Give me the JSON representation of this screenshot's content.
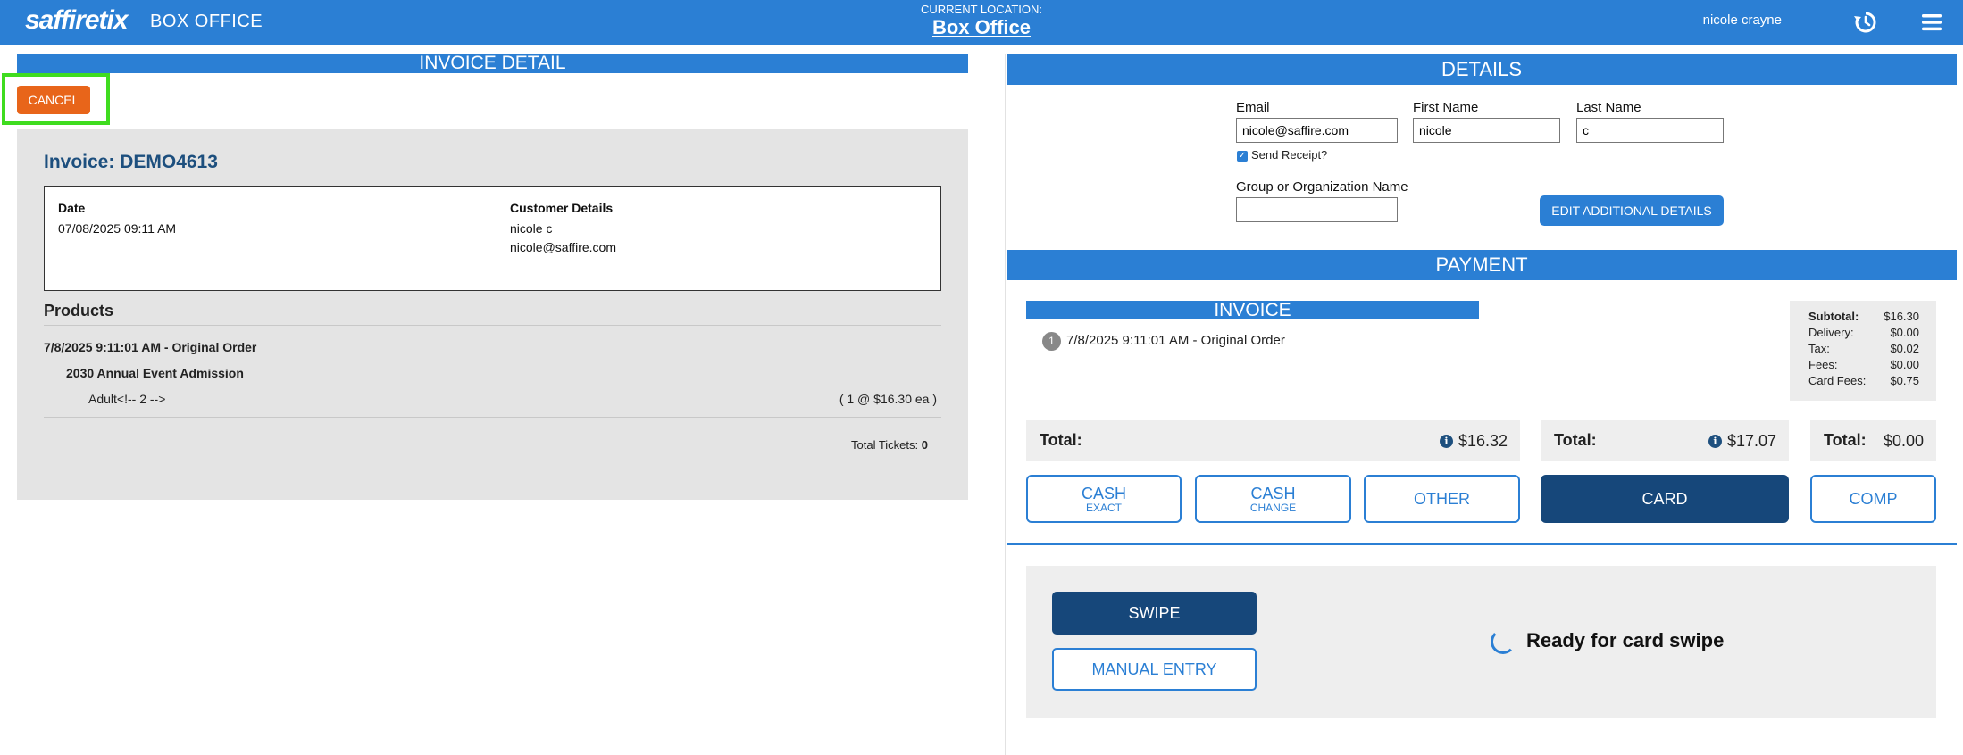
{
  "app": {
    "logo": "saffiretix",
    "title": "BOX OFFICE"
  },
  "location": {
    "label": "CURRENT LOCATION:",
    "value": "Box Office"
  },
  "user": {
    "name": "nicole crayne"
  },
  "icons": {
    "history": "history-icon",
    "menu": "hamburger-menu-icon",
    "info": "info-icon",
    "spinner": "loading-spinner-icon",
    "check": "checkbox-checked-icon"
  },
  "colors": {
    "brand": "#2b7fd4",
    "dark": "#16477a",
    "cancel": "#e8651a",
    "highlight": "#3fdc1f"
  },
  "invoice_detail": {
    "header": "INVOICE DETAIL",
    "cancel_label": "CANCEL",
    "title": "Invoice: DEMO4613",
    "date_label": "Date",
    "date_value": "07/08/2025 09:11 AM",
    "customer_label": "Customer Details",
    "customer_name": "nicole c",
    "customer_email": "nicole@saffire.com",
    "products_label": "Products",
    "order_line": "7/8/2025 9:11:01 AM - Original Order",
    "event_name": "2030 Annual Event Admission",
    "ticket_type": "Adult<!-- 2 -->",
    "ticket_qty": "( 1 @ $16.30 ea )",
    "total_tickets_label": "Total Tickets:",
    "total_tickets_value": "0"
  },
  "details": {
    "header": "DETAILS",
    "email_label": "Email",
    "email_value": "nicole@saffire.com",
    "first_name_label": "First Name",
    "first_name_value": "nicole",
    "last_name_label": "Last Name",
    "last_name_value": "c",
    "send_receipt_label": "Send Receipt?",
    "send_receipt_checked": true,
    "group_label": "Group or Organization Name",
    "group_value": "",
    "edit_button": "EDIT ADDITIONAL DETAILS"
  },
  "payment": {
    "header": "PAYMENT",
    "invoice_header": "INVOICE",
    "order_number": "1",
    "order_text": "7/8/2025 9:11:01 AM - Original Order",
    "summary": [
      {
        "label": "Subtotal:",
        "value": "$16.30"
      },
      {
        "label": "Delivery:",
        "value": "$0.00"
      },
      {
        "label": "Tax:",
        "value": "$0.02"
      },
      {
        "label": "Fees:",
        "value": "$0.00"
      },
      {
        "label": "Card Fees:",
        "value": "$0.75"
      }
    ],
    "totals": [
      {
        "label": "Total:",
        "value": "$16.32"
      },
      {
        "label": "Total:",
        "value": "$17.07"
      },
      {
        "label": "Total:",
        "value": "$0.00"
      }
    ],
    "buttons": {
      "cash_exact_main": "CASH",
      "cash_exact_sub": "EXACT",
      "cash_change_main": "CASH",
      "cash_change_sub": "CHANGE",
      "other": "OTHER",
      "card": "CARD",
      "comp": "COMP"
    },
    "swipe_label": "SWIPE",
    "manual_entry_label": "MANUAL ENTRY",
    "status": "Ready for card swipe"
  }
}
